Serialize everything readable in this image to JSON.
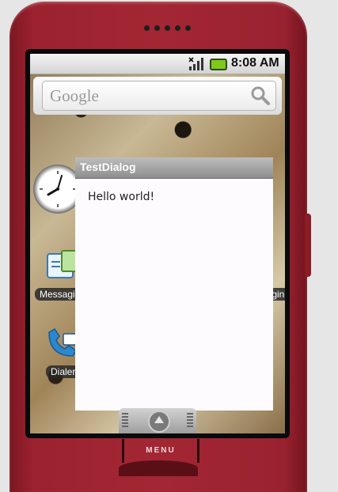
{
  "status_bar": {
    "time": "8:08 AM"
  },
  "search_widget": {
    "placeholder": "Google"
  },
  "home_screen": {
    "apps": [
      {
        "label": "Messaging"
      },
      {
        "label": "Dialer"
      },
      {
        "label": "Messaging"
      }
    ]
  },
  "dialog": {
    "title": "TestDialog",
    "message": "Hello world!"
  },
  "hardware": {
    "menu_key_label": "MENU"
  },
  "colors": {
    "phone_body": "#9c2230",
    "dialog_title_bar": "#8e8e8e",
    "battery": "#7ec81c"
  }
}
